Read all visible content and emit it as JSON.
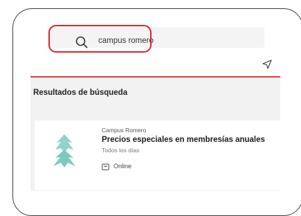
{
  "search": {
    "value": "campus romero"
  },
  "results": {
    "section_title": "Resultados de búsqueda",
    "items": [
      {
        "organization": "Campus Romero",
        "title": "Precios especiales en membresías anuales",
        "schedule": "Todos los días",
        "mode": "Online",
        "logo_icon": "campus-romero-logo"
      }
    ]
  },
  "colors": {
    "accent": "#e23a3f",
    "highlight": "#e0202a",
    "logo": "#8fd3c9"
  }
}
